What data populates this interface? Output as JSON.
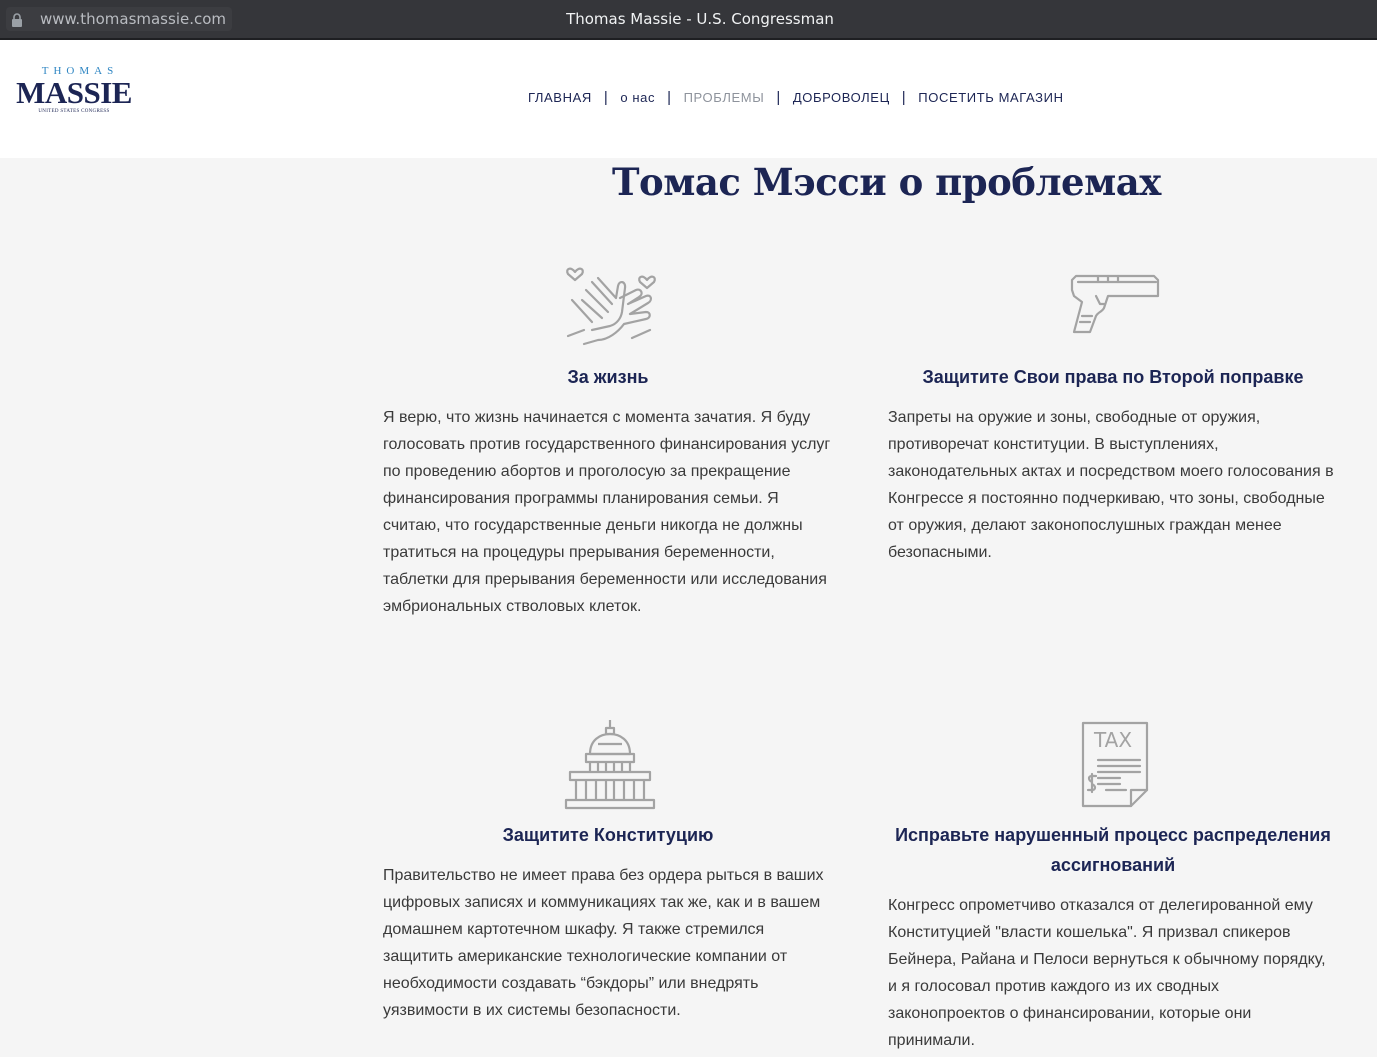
{
  "browser": {
    "url": "www.thomasmassie.com",
    "title": "Thomas Massie - U.S. Congressman"
  },
  "logo": {
    "top": "THOMAS",
    "main": "MASSIE",
    "sub": "UNITED STATES CONGRESS"
  },
  "nav": {
    "items": [
      {
        "label": "ГЛАВНАЯ"
      },
      {
        "label": "о нас"
      },
      {
        "label": "ПРОБЛЕМЫ"
      },
      {
        "label": "ДОБРОВОЛЕЦ"
      },
      {
        "label": "ПОСЕТИТЬ МАГАЗИН"
      }
    ],
    "separator": "|"
  },
  "main": {
    "title": "Томас Мэсси о проблемах",
    "issues": [
      {
        "icon": "heart-hands-icon",
        "title": "За жизнь",
        "body": "Я верю, что жизнь начинается с момента зачатия. Я буду голосовать против государственного финансирования услуг по проведению абортов и проголосую за прекращение финансирования программы планирования семьи. Я считаю, что государственные деньги никогда не должны тратиться на процедуры прерывания беременности, таблетки для прерывания беременности или исследования эмбриональных стволовых клеток."
      },
      {
        "icon": "handgun-icon",
        "title": "Защитите Свои права по Второй поправке",
        "body": "Запреты на оружие и зоны, свободные от оружия, противоречат конституции. В выступлениях, законодательных актах и посредством моего голосования в Конгрессе я постоянно подчеркиваю, что зоны, свободные от оружия, делают законопослушных граждан менее безопасными."
      },
      {
        "icon": "capitol-icon",
        "title": "Защитите Конституцию",
        "body": "Правительство не имеет права без ордера рыться в ваших цифровых записях и коммуникациях так же, как и в вашем домашнем картотечном шкафу. Я также стремился защитить американские технологические компании от необходимости создавать “бэкдоры” или внедрять уязвимости в их системы безопасности."
      },
      {
        "icon": "tax-document-icon",
        "icon_text": "TAX",
        "icon_symbol": "$",
        "title": "Исправьте нарушенный процесс распределения ассигнований",
        "body": "Конгресс опрометчиво отказался от делегированной ему Конституцией \"власти кошелька\". Я призвал спикеров Бейнера, Райана и Пелоси вернуться к обычному порядку, и я голосовал против каждого из их сводных законопроектов о финансировании, которые они принимали."
      }
    ]
  }
}
